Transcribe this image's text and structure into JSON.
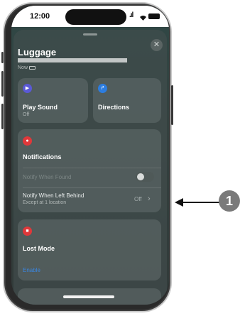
{
  "status_bar": {
    "time": "12:00",
    "signal": ".ıl",
    "wifi_icon": "wifi-icon"
  },
  "sheet": {
    "title": "Luggage",
    "last_seen": "Now",
    "close_label": "✕"
  },
  "actions": {
    "play_sound": {
      "label": "Play Sound",
      "status": "Off",
      "icon": "play-icon",
      "color": "#5a59d6"
    },
    "directions": {
      "label": "Directions",
      "icon": "directions-icon",
      "color": "#2c7de0"
    }
  },
  "notifications": {
    "heading": "Notifications",
    "icon": "bell-icon",
    "color": "#e0383a",
    "notify_found": {
      "label": "Notify When Found",
      "enabled": false
    },
    "notify_left_behind": {
      "label": "Notify When Left Behind",
      "detail": "Except at 1 location",
      "value": "Off",
      "chevron": "›"
    }
  },
  "lost_mode": {
    "heading": "Lost Mode",
    "icon": "lock-icon",
    "color": "#e0383a",
    "action": "Enable"
  },
  "callout": {
    "number": "1"
  }
}
